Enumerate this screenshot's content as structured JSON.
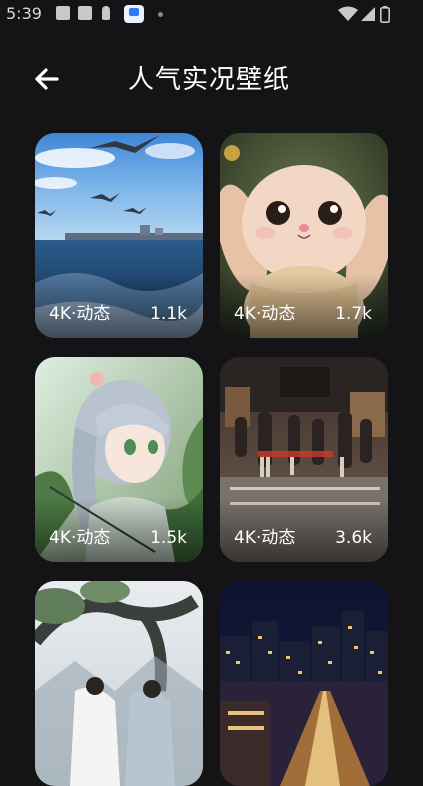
{
  "status_bar": {
    "time": "5:39"
  },
  "header": {
    "title": "人气实况壁纸"
  },
  "wallpapers": [
    {
      "label": "4K·动态",
      "count": "1.1k"
    },
    {
      "label": "4K·动态",
      "count": "1.7k"
    },
    {
      "label": "4K·动态",
      "count": "1.5k"
    },
    {
      "label": "4K·动态",
      "count": "3.6k"
    },
    {
      "label": "",
      "count": ""
    },
    {
      "label": "",
      "count": ""
    }
  ]
}
